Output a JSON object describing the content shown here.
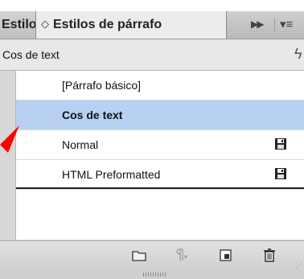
{
  "tabs": {
    "inactive_label": "Estilos de carácter",
    "active_label": "Estilos de párrafo",
    "updown_glyph": "◇"
  },
  "current_style": {
    "label": "Cos de text"
  },
  "styles": [
    {
      "label": "[Párrafo básico]",
      "selected": false,
      "saved": false
    },
    {
      "label": "Cos de text",
      "selected": true,
      "saved": false
    },
    {
      "label": "Normal",
      "selected": false,
      "saved": true
    },
    {
      "label": "HTML Preformatted",
      "selected": false,
      "saved": true
    }
  ],
  "colors": {
    "selection": "#b8d1f3",
    "arrow": "#ff0000"
  },
  "toolbar_icons": [
    "new-group-icon",
    "clear-overrides-icon",
    "new-style-icon",
    "trash-icon"
  ]
}
